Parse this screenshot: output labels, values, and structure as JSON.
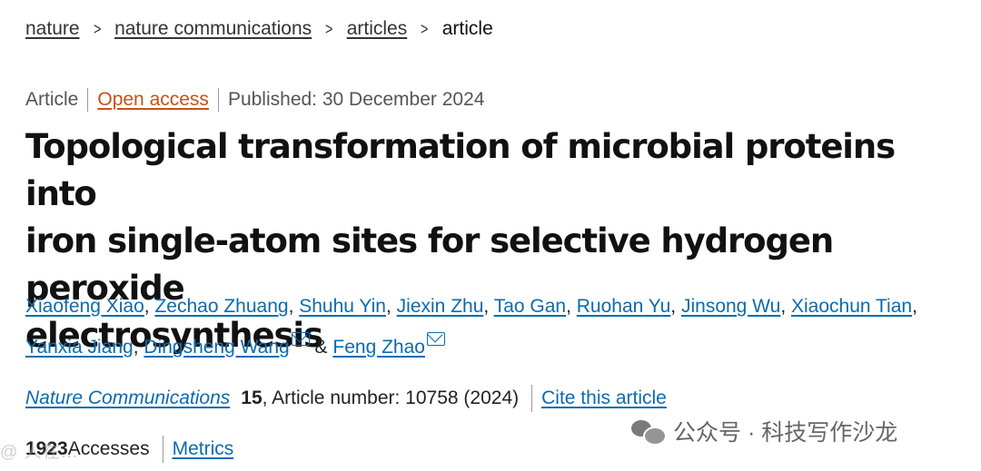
{
  "breadcrumb": {
    "items": [
      "nature",
      "nature communications",
      "articles"
    ],
    "current": "article"
  },
  "meta": {
    "type": "Article",
    "access": "Open access",
    "published": "Published: 30 December 2024"
  },
  "title_lines": [
    "Topological transformation of microbial proteins into",
    "iron single-atom sites for selective hydrogen peroxide",
    "electrosynthesis"
  ],
  "authors": [
    "Xiaofeng Xiao",
    "Zechao Zhuang",
    "Shuhu Yin",
    "Jiexin Zhu",
    "Tao Gan",
    "Ruohan Yu",
    "Jinsong Wu",
    "Xiaochun Tian",
    "Yanxia Jiang",
    "Dingsheng Wang",
    "Feng Zhao"
  ],
  "author_sep": ", ",
  "author_and": " & ",
  "citation": {
    "journal": "Nature Communications",
    "volume": "15",
    "article_number": ", Article number: 10758 (2024)",
    "cite_link": "Cite this article"
  },
  "access": {
    "count": "1923",
    "label": " Accesses",
    "metrics_link": "Metrics"
  },
  "watermark": {
    "text": "公众号 · 科技写作沙龙",
    "left_text": "@ 人在…"
  },
  "icons": {
    "mail": "envelope-icon",
    "chevron": "chevron-right-icon",
    "wechat": "wechat-icon"
  },
  "colors": {
    "link": "#0b6bb0",
    "open_access": "#c4521b",
    "title": "#111111"
  }
}
